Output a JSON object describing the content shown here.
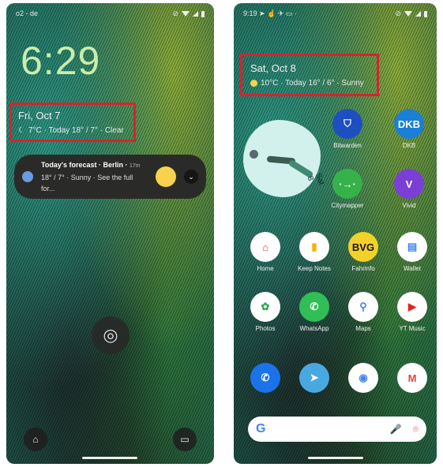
{
  "left": {
    "status": {
      "carrier": "o2 - de"
    },
    "clock": "6:29",
    "date": "Fri, Oct 7",
    "weather": "7°C · Today 18° / 7° · Clear",
    "notification": {
      "title": "Today's forecast · Berlin ·",
      "time": "17m",
      "body": "18° / 7° · Sunny · See the full for...",
      "expand": "⌄"
    },
    "icons": {
      "fingerprint": "◎",
      "home": "⌂",
      "wallet": "▭"
    }
  },
  "right": {
    "status": {
      "time": "9:19"
    },
    "date": "Sat, Oct 8",
    "weather": "10°C · Today 16° / 6° · Sunny",
    "clock_widget": {
      "label": "Sat 8"
    },
    "apps": [
      {
        "label": "Bitwarden",
        "glyph": "⛉",
        "bg": "#1d4fc0",
        "fg": "#fff"
      },
      {
        "label": "DKB",
        "glyph": "DKB",
        "bg": "#1b7fd6",
        "fg": "#fff"
      },
      {
        "label": "Citymapper",
        "glyph": "·→·",
        "bg": "#35b24a",
        "fg": "#fff"
      },
      {
        "label": "Vivid",
        "glyph": "V",
        "bg": "#7b3fd8",
        "fg": "#fff"
      },
      {
        "label": "Home",
        "glyph": "⌂",
        "bg": "#fff",
        "fg": "#ea4335"
      },
      {
        "label": "Keep Notes",
        "glyph": "▮",
        "bg": "#fff",
        "fg": "#f6b400"
      },
      {
        "label": "Fahrinfo",
        "glyph": "BVG",
        "bg": "#f3d12b",
        "fg": "#111"
      },
      {
        "label": "Wallet",
        "glyph": "▤",
        "bg": "#fff",
        "fg": "#4285f4"
      },
      {
        "label": "Photos",
        "glyph": "✿",
        "bg": "#fff",
        "fg": "#34a853"
      },
      {
        "label": "WhatsApp",
        "glyph": "✆",
        "bg": "#2fbf56",
        "fg": "#fff"
      },
      {
        "label": "Maps",
        "glyph": "⚲",
        "bg": "#fff",
        "fg": "#4285f4"
      },
      {
        "label": "YT Music",
        "glyph": "▶",
        "bg": "#fff",
        "fg": "#e5221f"
      }
    ],
    "dock": [
      {
        "label": "Phone",
        "glyph": "✆",
        "bg": "#1a73e8",
        "fg": "#fff"
      },
      {
        "label": "Telegram",
        "glyph": "➤",
        "bg": "#4aa8e0",
        "fg": "#fff"
      },
      {
        "label": "Chrome",
        "glyph": "◉",
        "bg": "#fff",
        "fg": "#4285f4"
      },
      {
        "label": "Gmail",
        "glyph": "M",
        "bg": "#fff",
        "fg": "#ea4335"
      }
    ],
    "search": {
      "logo": "G",
      "mic": "🎤",
      "lens": "⌾"
    }
  },
  "colors": {
    "highlight": "#d6232d"
  }
}
